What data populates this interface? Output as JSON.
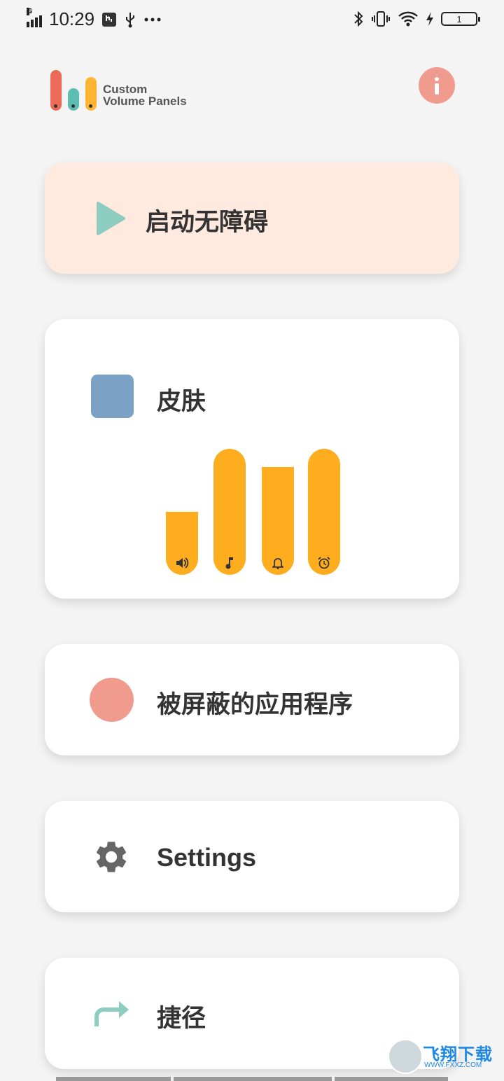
{
  "status_bar": {
    "time": "10:29",
    "network_type": "G",
    "battery_level": "1",
    "icons": [
      "signal-icon",
      "usb-debug-icon",
      "usb-icon",
      "more-dots-icon",
      "bluetooth-icon",
      "vibrate-icon",
      "wifi-icon",
      "charging-icon",
      "battery-icon"
    ]
  },
  "header": {
    "logo_line1": "Custom",
    "logo_line2": "Volume Panels",
    "info_icon": "info-icon",
    "info_glyph": "i"
  },
  "menu": {
    "start_label": "启动无障碍",
    "skin_label": "皮肤",
    "blocked_apps_label": "被屏蔽的应用程序",
    "settings_label": "Settings",
    "shortcut_label": "捷径"
  },
  "skin_preview": {
    "bars": [
      {
        "name": "media",
        "icon": "volume-icon",
        "level": 0.51
      },
      {
        "name": "music",
        "icon": "music-note-icon",
        "level": 1.0
      },
      {
        "name": "ring",
        "icon": "bell-icon",
        "level": 0.86
      },
      {
        "name": "alarm",
        "icon": "alarm-icon",
        "level": 1.0
      }
    ],
    "bar_color": "#fdad1e"
  },
  "watermark": {
    "text": "飞翔下载",
    "url": "WWW.FXXZ.COM"
  },
  "colors": {
    "accent_red": "#ec6b57",
    "accent_teal": "#5dbdb3",
    "accent_yellow": "#fdb531",
    "start_card_bg": "#feeadf",
    "skin_swatch": "#7ba2c4",
    "blocked_dot": "#f19a8e",
    "play_icon": "#8ccdbf"
  }
}
